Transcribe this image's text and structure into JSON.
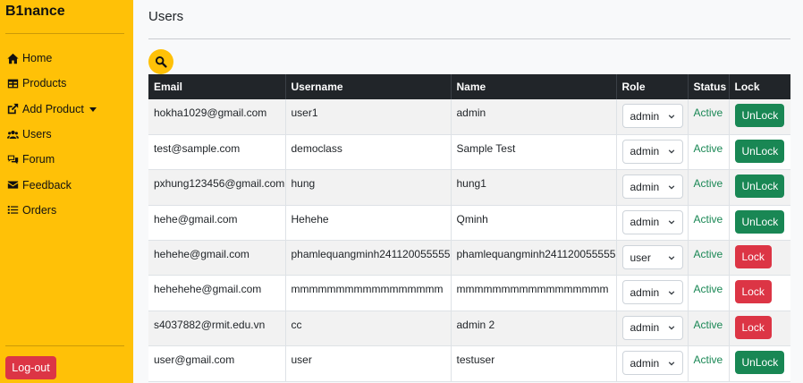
{
  "brand": "B1nance",
  "sidebar": {
    "items": [
      {
        "label": "Home",
        "icon": "home-icon"
      },
      {
        "label": "Products",
        "icon": "table-icon"
      },
      {
        "label": "Add Product",
        "icon": "external-link-icon"
      },
      {
        "label": "Users",
        "icon": "users-icon"
      },
      {
        "label": "Forum",
        "icon": "comments-icon"
      },
      {
        "label": "Feedback",
        "icon": "envelope-icon"
      },
      {
        "label": "Orders",
        "icon": "list-icon"
      }
    ],
    "logout_label": "Log-out"
  },
  "main": {
    "title": "Users",
    "table": {
      "headers": [
        "Email",
        "Username",
        "Name",
        "Role",
        "Status",
        "Lock"
      ],
      "rows": [
        {
          "email": "hokha1029@gmail.com",
          "username": "user1",
          "name": "admin",
          "role": "admin",
          "status": "Active",
          "lock": "UnLock"
        },
        {
          "email": "test@sample.com",
          "username": "democlass",
          "name": "Sample Test",
          "role": "admin",
          "status": "Active",
          "lock": "UnLock"
        },
        {
          "email": "pxhung123456@gmail.com",
          "username": "hung",
          "name": "hung1",
          "role": "admin",
          "status": "Active",
          "lock": "UnLock"
        },
        {
          "email": "hehe@gmail.com",
          "username": "Hehehe",
          "name": "Qminh",
          "role": "admin",
          "status": "Active",
          "lock": "UnLock"
        },
        {
          "email": "hehehe@gmail.com",
          "username": "phamlequangminh241120055555",
          "name": "phamlequangminh241120055555",
          "role": "user",
          "status": "Active",
          "lock": "Lock"
        },
        {
          "email": "hehehehe@gmail.com",
          "username": "mmmmmmmmmmmmmmmmm",
          "name": "mmmmmmmmmmmmmmmmm",
          "role": "admin",
          "status": "Active",
          "lock": "Lock"
        },
        {
          "email": "s4037882@rmit.edu.vn",
          "username": "cc",
          "name": "admin 2",
          "role": "admin",
          "status": "Active",
          "lock": "Lock"
        },
        {
          "email": "user@gmail.com",
          "username": "user",
          "name": "testuser",
          "role": "admin",
          "status": "Active",
          "lock": "UnLock"
        }
      ]
    }
  },
  "colors": {
    "sidebar_bg": "#ffc107",
    "header_bg": "#212529",
    "active": "#198754",
    "unlock_btn": "#198754",
    "lock_btn": "#dc3545"
  }
}
